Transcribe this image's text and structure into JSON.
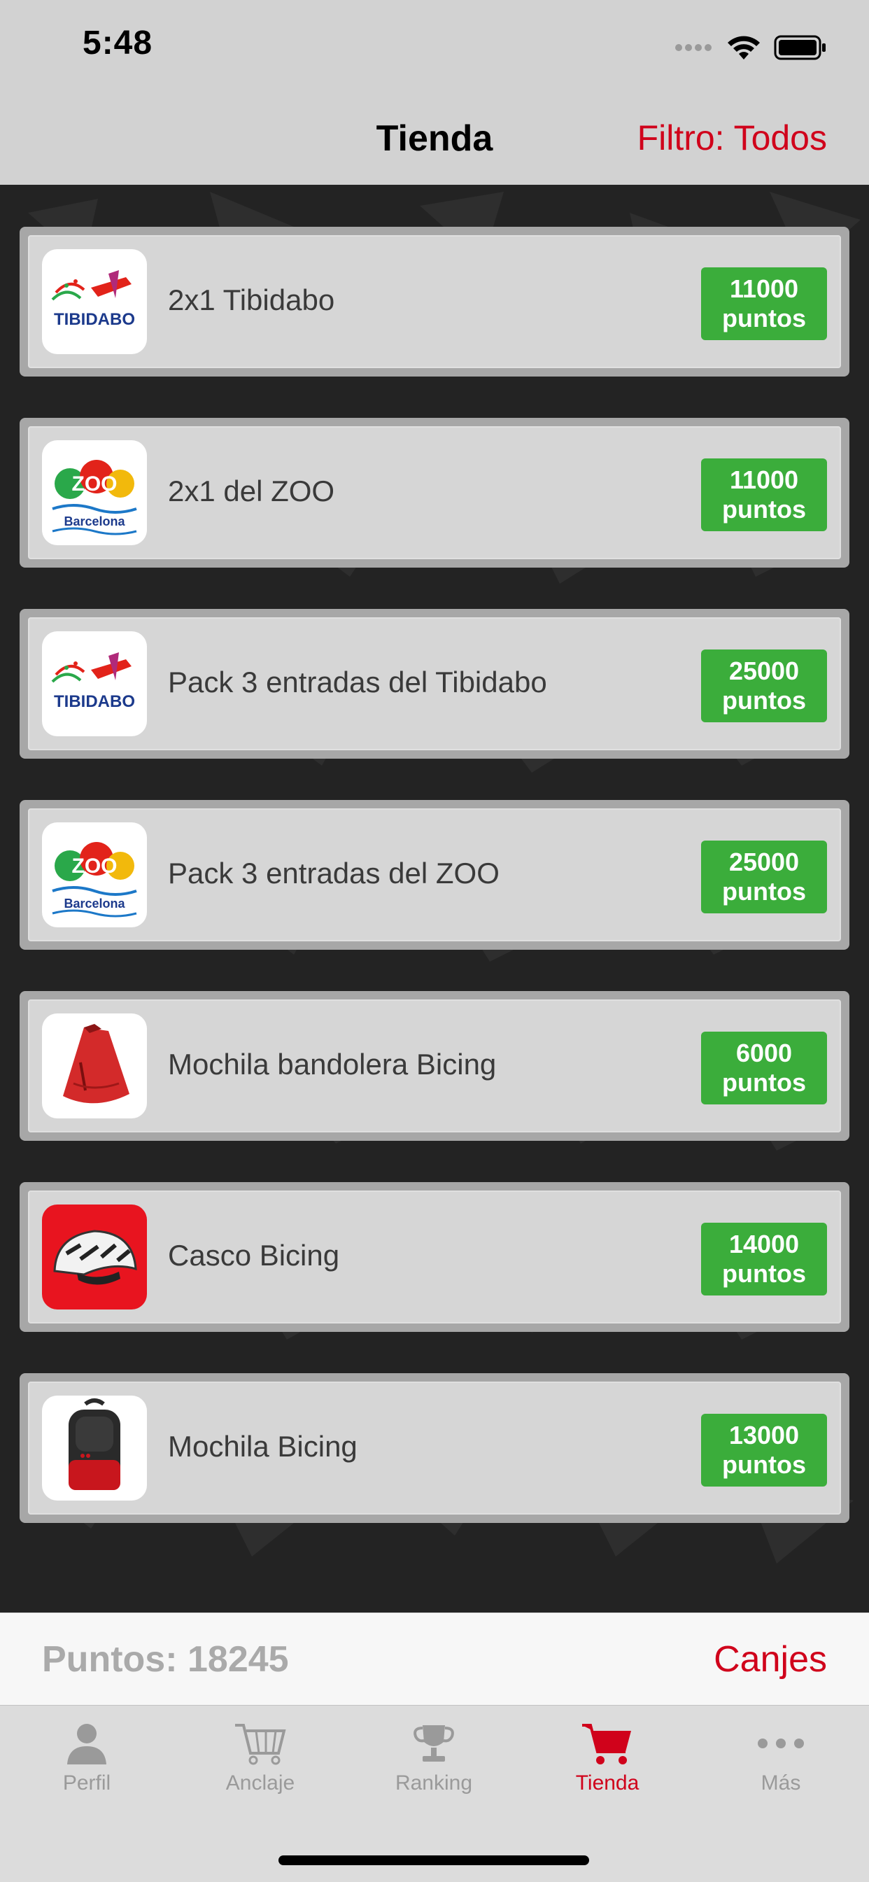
{
  "status": {
    "time": "5:48"
  },
  "header": {
    "title": "Tienda",
    "filter_label": "Filtro: Todos"
  },
  "items": [
    {
      "title": "2x1 Tibidabo",
      "points": "11000",
      "unit": "puntos",
      "icon": "tibidabo-logo"
    },
    {
      "title": "2x1 del ZOO",
      "points": "11000",
      "unit": "puntos",
      "icon": "zoo-barcelona-logo"
    },
    {
      "title": "Pack 3 entradas del Tibidabo",
      "points": "25000",
      "unit": "puntos",
      "icon": "tibidabo-logo"
    },
    {
      "title": "Pack 3 entradas del ZOO",
      "points": "25000",
      "unit": "puntos",
      "icon": "zoo-barcelona-logo"
    },
    {
      "title": "Mochila bandolera Bicing",
      "points": "6000",
      "unit": "puntos",
      "icon": "sling-bag-image"
    },
    {
      "title": "Casco Bicing",
      "points": "14000",
      "unit": "puntos",
      "icon": "helmet-image"
    },
    {
      "title": "Mochila Bicing",
      "points": "13000",
      "unit": "puntos",
      "icon": "backpack-image"
    }
  ],
  "footer": {
    "points_label": "Puntos: 18245",
    "canjes_label": "Canjes"
  },
  "tabs": [
    {
      "label": "Perfil",
      "icon": "person-icon"
    },
    {
      "label": "Anclaje",
      "icon": "cart-outline-icon"
    },
    {
      "label": "Ranking",
      "icon": "trophy-icon"
    },
    {
      "label": "Tienda",
      "icon": "shopping-cart-icon",
      "active": true
    },
    {
      "label": "Más",
      "icon": "more-icon"
    }
  ],
  "colors": {
    "accent": "#d0021b",
    "price_green": "#3bad3b"
  },
  "zoo_text": {
    "zoo": "ZOO",
    "city": "Barcelona"
  },
  "tibidabo_text": "TIBIDABO"
}
